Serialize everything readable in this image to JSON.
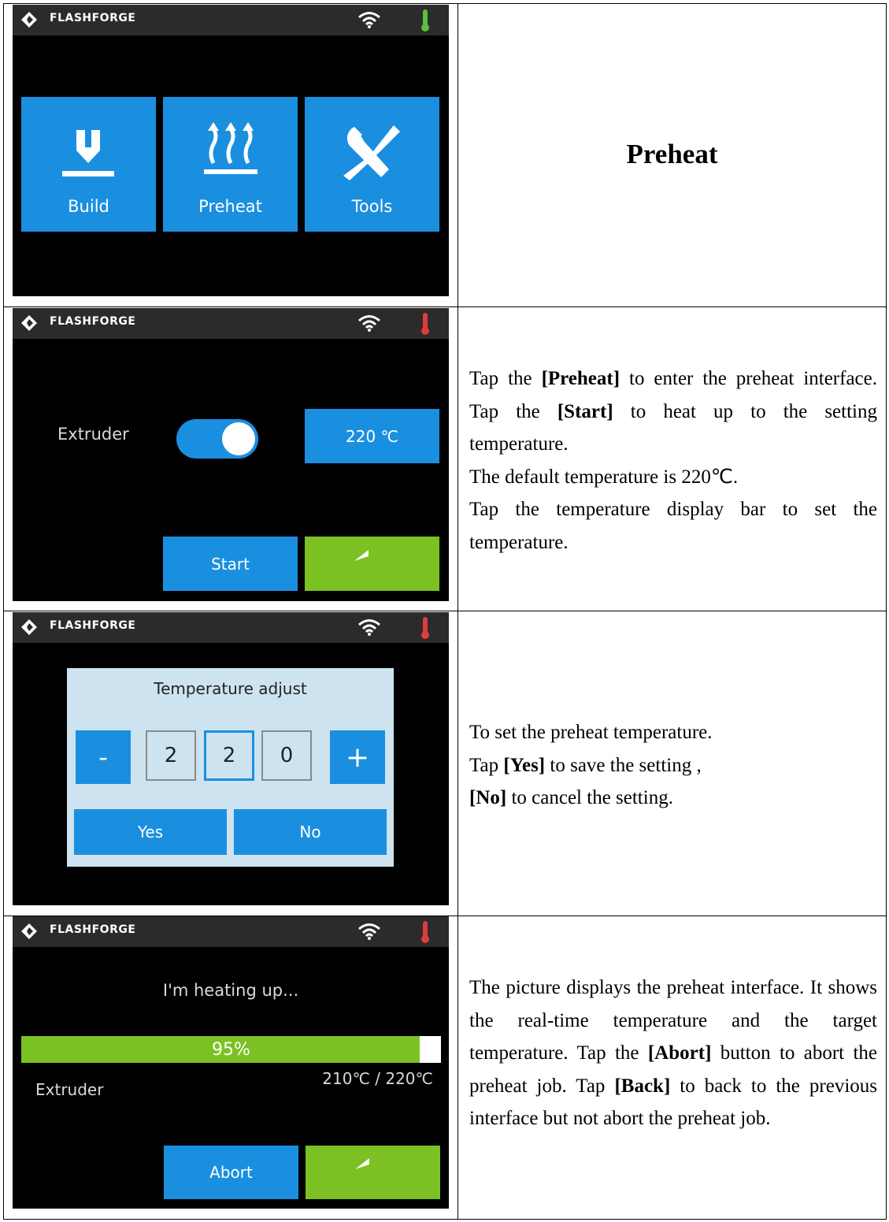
{
  "brand": "FLASHFORGE",
  "colors": {
    "accent_blue": "#1a8fe0",
    "accent_green": "#7cc124",
    "thermo_cool": "#5bbf3a",
    "thermo_hot": "#e03b3b",
    "dialog_bg": "#cde3f0"
  },
  "row1": {
    "title": "Preheat",
    "tiles": [
      {
        "label": "Build",
        "icon": "build-icon"
      },
      {
        "label": "Preheat",
        "icon": "preheat-icon"
      },
      {
        "label": "Tools",
        "icon": "tools-icon"
      }
    ]
  },
  "row2": {
    "extruder_label": "Extruder",
    "temp_button": "220 ℃",
    "start_button": "Start",
    "toggle_on": true,
    "desc": {
      "p1_a": "Tap the ",
      "p1_b": "[Preheat]",
      "p1_c": " to enter the preheat interface. Tap the ",
      "p1_d": "[Start]",
      "p1_e": " to heat up to the setting temperature.",
      "p2": "The default temperature is 220℃.",
      "p3": "Tap the temperature display bar to set the temperature."
    }
  },
  "row3": {
    "dialog_title": "Temperature adjust",
    "minus": "-",
    "plus": "+",
    "digits": [
      "2",
      "2",
      "0"
    ],
    "yes": "Yes",
    "no": "No",
    "desc": {
      "p1": "To set the preheat temperature.",
      "p2_a": "Tap ",
      "p2_b": "[Yes]",
      "p2_c": " to save the setting ,",
      "p3_a": "[No]",
      "p3_b": " to cancel the setting."
    }
  },
  "row4": {
    "heating_text": "I'm heating up...",
    "progress_label": "95%",
    "progress_value": 0.95,
    "extruder_label": "Extruder",
    "temp_readout": "210℃ / 220℃",
    "abort_button": "Abort",
    "desc": {
      "a": "The picture displays the preheat interface. It shows the real-time temperature and the target temperature. Tap the ",
      "b": "[Abort]",
      "c": " button to abort the preheat job. Tap ",
      "d": "[Back]",
      "e": " to back to the previous interface but not abort the preheat job."
    }
  }
}
